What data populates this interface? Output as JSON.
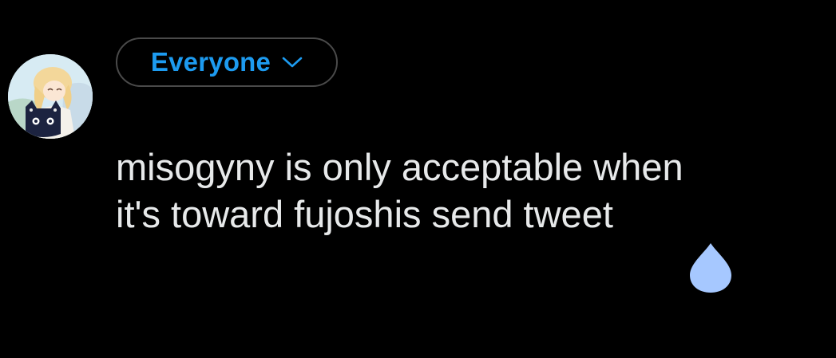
{
  "composer": {
    "audience_label": "Everyone",
    "text": "misogyny is only acceptable when\nit's toward fujoshis send tweet"
  },
  "icons": {
    "audience_chevron": "chevron-down-icon",
    "drop": "water-drop-icon"
  },
  "colors": {
    "background": "#000000",
    "accent": "#1d9bf0",
    "text": "#e7e9ea",
    "pill_border": "#4a4a4a",
    "drop": "#a6c8ff"
  }
}
